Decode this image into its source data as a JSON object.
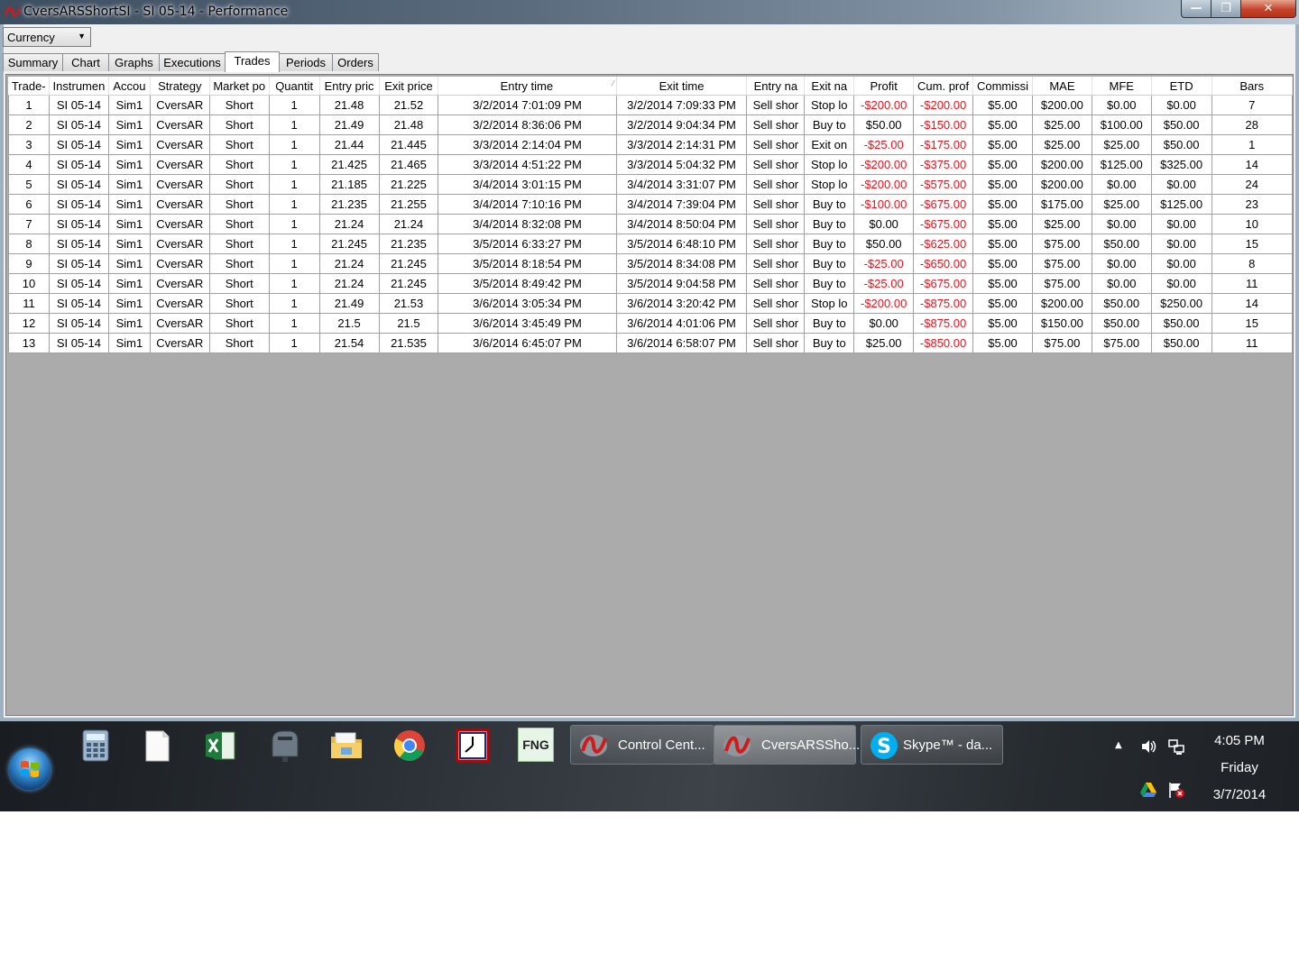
{
  "window": {
    "title": "CversARSShortSI - SI 05-14 - Performance",
    "caption_min": "—",
    "caption_max": "❐",
    "caption_close": "✕"
  },
  "toolbar": {
    "display_unit": "Currency",
    "dropdown_arrow": "▼"
  },
  "tabs": [
    {
      "label": "Summary",
      "active": false
    },
    {
      "label": "Chart",
      "active": false
    },
    {
      "label": "Graphs",
      "active": false
    },
    {
      "label": "Executions",
      "active": false
    },
    {
      "label": "Trades",
      "active": true
    },
    {
      "label": "Periods",
      "active": false
    },
    {
      "label": "Orders",
      "active": false
    }
  ],
  "table": {
    "columns": [
      "Trade-",
      "Instrumen",
      "Accou",
      "Strategy",
      "Market po",
      "Quantit",
      "Entry pric",
      "Exit price",
      "Entry time",
      "Exit time",
      "Entry na",
      "Exit na",
      "Profit",
      "Cum. prof",
      "Commissi",
      "MAE",
      "MFE",
      "ETD",
      "Bars"
    ],
    "sort_indicator": "⁄",
    "rows": [
      [
        "1",
        "SI 05-14",
        "Sim1",
        "CversAR",
        "Short",
        "1",
        "21.48",
        "21.52",
        "3/2/2014 7:01:09 PM",
        "3/2/2014 7:09:33 PM",
        "Sell shor",
        "Stop lo",
        "-$200.00",
        "-$200.00",
        "$5.00",
        "$200.00",
        "$0.00",
        "$0.00",
        "7"
      ],
      [
        "2",
        "SI 05-14",
        "Sim1",
        "CversAR",
        "Short",
        "1",
        "21.49",
        "21.48",
        "3/2/2014 8:36:06 PM",
        "3/2/2014 9:04:34 PM",
        "Sell shor",
        "Buy to",
        "$50.00",
        "-$150.00",
        "$5.00",
        "$25.00",
        "$100.00",
        "$50.00",
        "28"
      ],
      [
        "3",
        "SI 05-14",
        "Sim1",
        "CversAR",
        "Short",
        "1",
        "21.44",
        "21.445",
        "3/3/2014 2:14:04 PM",
        "3/3/2014 2:14:31 PM",
        "Sell shor",
        "Exit on",
        "-$25.00",
        "-$175.00",
        "$5.00",
        "$25.00",
        "$25.00",
        "$50.00",
        "1"
      ],
      [
        "4",
        "SI 05-14",
        "Sim1",
        "CversAR",
        "Short",
        "1",
        "21.425",
        "21.465",
        "3/3/2014 4:51:22 PM",
        "3/3/2014 5:04:32 PM",
        "Sell shor",
        "Stop lo",
        "-$200.00",
        "-$375.00",
        "$5.00",
        "$200.00",
        "$125.00",
        "$325.00",
        "14"
      ],
      [
        "5",
        "SI 05-14",
        "Sim1",
        "CversAR",
        "Short",
        "1",
        "21.185",
        "21.225",
        "3/4/2014 3:01:15 PM",
        "3/4/2014 3:31:07 PM",
        "Sell shor",
        "Stop lo",
        "-$200.00",
        "-$575.00",
        "$5.00",
        "$200.00",
        "$0.00",
        "$0.00",
        "24"
      ],
      [
        "6",
        "SI 05-14",
        "Sim1",
        "CversAR",
        "Short",
        "1",
        "21.235",
        "21.255",
        "3/4/2014 7:10:16 PM",
        "3/4/2014 7:39:04 PM",
        "Sell shor",
        "Buy to",
        "-$100.00",
        "-$675.00",
        "$5.00",
        "$175.00",
        "$25.00",
        "$125.00",
        "23"
      ],
      [
        "7",
        "SI 05-14",
        "Sim1",
        "CversAR",
        "Short",
        "1",
        "21.24",
        "21.24",
        "3/4/2014 8:32:08 PM",
        "3/4/2014 8:50:04 PM",
        "Sell shor",
        "Buy to",
        "$0.00",
        "-$675.00",
        "$5.00",
        "$25.00",
        "$0.00",
        "$0.00",
        "10"
      ],
      [
        "8",
        "SI 05-14",
        "Sim1",
        "CversAR",
        "Short",
        "1",
        "21.245",
        "21.235",
        "3/5/2014 6:33:27 PM",
        "3/5/2014 6:48:10 PM",
        "Sell shor",
        "Buy to",
        "$50.00",
        "-$625.00",
        "$5.00",
        "$75.00",
        "$50.00",
        "$0.00",
        "15"
      ],
      [
        "9",
        "SI 05-14",
        "Sim1",
        "CversAR",
        "Short",
        "1",
        "21.24",
        "21.245",
        "3/5/2014 8:18:54 PM",
        "3/5/2014 8:34:08 PM",
        "Sell shor",
        "Buy to",
        "-$25.00",
        "-$650.00",
        "$5.00",
        "$75.00",
        "$0.00",
        "$0.00",
        "8"
      ],
      [
        "10",
        "SI 05-14",
        "Sim1",
        "CversAR",
        "Short",
        "1",
        "21.24",
        "21.245",
        "3/5/2014 8:49:42 PM",
        "3/5/2014 9:04:58 PM",
        "Sell shor",
        "Buy to",
        "-$25.00",
        "-$675.00",
        "$5.00",
        "$75.00",
        "$0.00",
        "$0.00",
        "11"
      ],
      [
        "11",
        "SI 05-14",
        "Sim1",
        "CversAR",
        "Short",
        "1",
        "21.49",
        "21.53",
        "3/6/2014 3:05:34 PM",
        "3/6/2014 3:20:42 PM",
        "Sell shor",
        "Stop lo",
        "-$200.00",
        "-$875.00",
        "$5.00",
        "$200.00",
        "$50.00",
        "$250.00",
        "14"
      ],
      [
        "12",
        "SI 05-14",
        "Sim1",
        "CversAR",
        "Short",
        "1",
        "21.5",
        "21.5",
        "3/6/2014 3:45:49 PM",
        "3/6/2014 4:01:06 PM",
        "Sell shor",
        "Buy to",
        "$0.00",
        "-$875.00",
        "$5.00",
        "$150.00",
        "$50.00",
        "$50.00",
        "15"
      ],
      [
        "13",
        "SI 05-14",
        "Sim1",
        "CversAR",
        "Short",
        "1",
        "21.54",
        "21.535",
        "3/6/2014 6:45:07 PM",
        "3/6/2014 6:58:07 PM",
        "Sell shor",
        "Buy to",
        "$25.00",
        "-$850.00",
        "$5.00",
        "$75.00",
        "$75.00",
        "$50.00",
        "11"
      ]
    ]
  },
  "taskbar": {
    "pinned": [
      {
        "name": "calculator-icon"
      },
      {
        "name": "blank-document-icon"
      },
      {
        "name": "excel-icon"
      },
      {
        "name": "mailbox-icon"
      },
      {
        "name": "file-explorer-icon"
      },
      {
        "name": "chrome-icon"
      },
      {
        "name": "clock-app-icon"
      },
      {
        "name": "fng-icon",
        "label": "FNG"
      }
    ],
    "tasks": [
      {
        "label": "Control Cent...",
        "icon": "ninjatrader-icon",
        "active": false
      },
      {
        "label": "CversARSSho...",
        "icon": "ninjatrader-icon",
        "active": true
      },
      {
        "label": "Skype™ - da...",
        "icon": "skype-icon",
        "active": false
      }
    ],
    "tray_expand": "▲",
    "clock": {
      "time": "4:05 PM",
      "day": "Friday",
      "date": "3/7/2014"
    }
  },
  "colors": {
    "negative": "#e0141e",
    "grid_background": "#ababab"
  }
}
